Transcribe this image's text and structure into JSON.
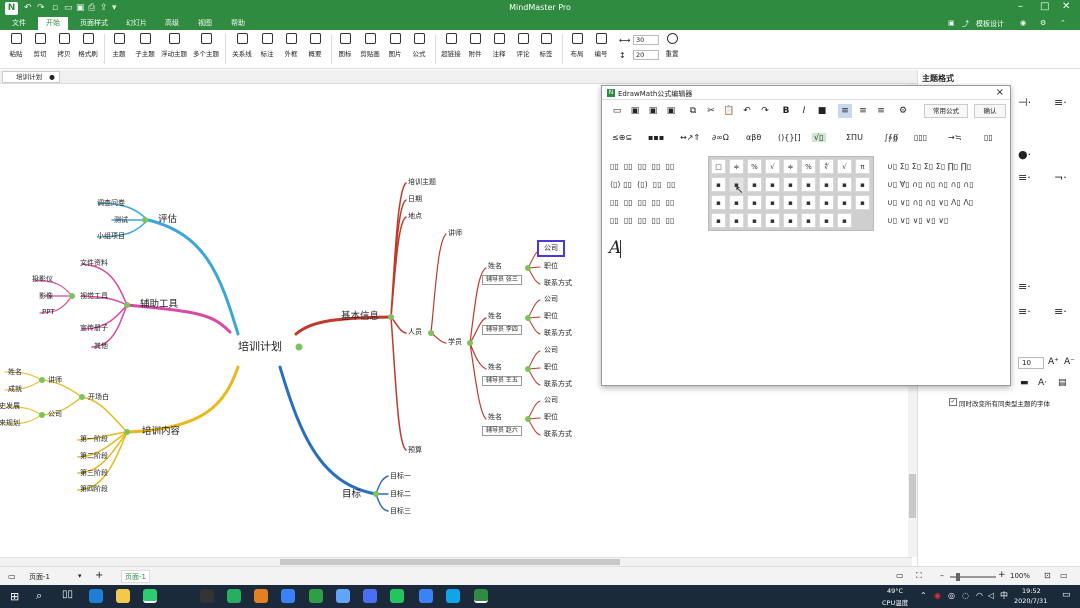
{
  "window": {
    "title": "MindMaster Pro",
    "logo": "N"
  },
  "menu": {
    "items": [
      "文件",
      "开始",
      "页面样式",
      "幻灯片",
      "高级",
      "视图",
      "帮助"
    ],
    "right": [
      "模板设计"
    ]
  },
  "ribbon": {
    "buttons": [
      "粘贴",
      "剪切",
      "拷贝",
      "格式刷",
      "主题",
      "子主题",
      "浮动主题",
      "多个主题",
      "关系线",
      "标注",
      "外框",
      "概要",
      "图标",
      "剪贴画",
      "图片",
      "公式",
      "超链接",
      "附件",
      "注释",
      "评论",
      "标签",
      "布局",
      "编号",
      "重置"
    ],
    "spin1": "30",
    "spin2": "20"
  },
  "doc": {
    "tab": "培训计划"
  },
  "mindmap": {
    "center": "培训计划",
    "eval": {
      "title": "评估",
      "items": [
        "调查问卷",
        "测试",
        "小组项目"
      ]
    },
    "tools": {
      "title": "辅助工具",
      "items": [
        "文件资料",
        "视觉工具",
        "宣传册子",
        "其他"
      ],
      "visual": [
        "投影仪",
        "影像",
        "PPT"
      ]
    },
    "content": {
      "title": "培训内容",
      "opening": "开场白",
      "lecturer": "讲师",
      "company": "公司",
      "lecturer_items": [
        "姓名",
        "成就"
      ],
      "company_items": [
        "历史发展",
        "未来规划"
      ],
      "stages": [
        "第一阶段",
        "第二阶段",
        "第三阶段",
        "第四阶段"
      ]
    },
    "basic": {
      "title": "基本信息",
      "items": [
        "培训主题",
        "日期",
        "地点",
        "人员",
        "预算"
      ],
      "lecturer": "讲师",
      "trainee": "学员"
    },
    "trainees": [
      {
        "name": "姓名",
        "assistant": "辅导员 张三",
        "items": [
          "公司",
          "职位",
          "联系方式"
        ]
      },
      {
        "name": "姓名",
        "assistant": "辅导员 李四",
        "items": [
          "公司",
          "职位",
          "联系方式"
        ]
      },
      {
        "name": "姓名",
        "assistant": "辅导员 王五",
        "items": [
          "公司",
          "职位",
          "联系方式"
        ]
      },
      {
        "name": "姓名",
        "assistant": "辅导员 赵六",
        "items": [
          "公司",
          "职位",
          "联系方式"
        ]
      }
    ],
    "goals": {
      "title": "目标",
      "items": [
        "目标一",
        "目标二",
        "目标三"
      ]
    }
  },
  "dialog": {
    "title": "EdrawMath公式编辑器",
    "common_btn": "常用公式",
    "ok_btn": "确认",
    "symbol_groups": [
      "≤⊕⊆",
      "▪▪▪",
      "↔↗⇑",
      "∂∞Ω",
      "αβθ",
      "(){}[]",
      "√▯",
      "ΣΠU",
      "∫∮∯",
      "▯▯▯",
      "→≒",
      "▯▯"
    ],
    "grid_rows": [
      [
        "□",
        "≑",
        "%",
        "√",
        "≑",
        "%",
        "∜",
        "√",
        "π"
      ],
      [
        "▪",
        "▪",
        "▪",
        "▪",
        "▪",
        "▪",
        "▪",
        "▪",
        "▪"
      ],
      [
        "▪",
        "▪",
        "▪",
        "▪",
        "▪",
        "▪",
        "▪",
        "▪",
        "▪"
      ],
      [
        "▪",
        "▪",
        "▪",
        "▪",
        "▪",
        "▪",
        "▪",
        "▪"
      ]
    ],
    "cursor_text": "A"
  },
  "rightpanel": {
    "title": "主题格式",
    "font_size": "10",
    "checkbox_label": "同时改变所有同类型主题的字体"
  },
  "status": {
    "page_label": "页面-1",
    "page_tab": "页面-1",
    "zoom": "100%"
  },
  "taskbar": {
    "temp": "49°C",
    "cpu": "CPU温度",
    "time": "19:52",
    "date": "2020/7/31",
    "ime": "中"
  },
  "colors": {
    "brand": "#2e8b3f",
    "eval": "#3aa7d8",
    "tools": "#d94aa5",
    "content": "#e9b81a",
    "basic": "#c0392b",
    "goals": "#2a6fbf",
    "trainee": "#c0392b"
  }
}
